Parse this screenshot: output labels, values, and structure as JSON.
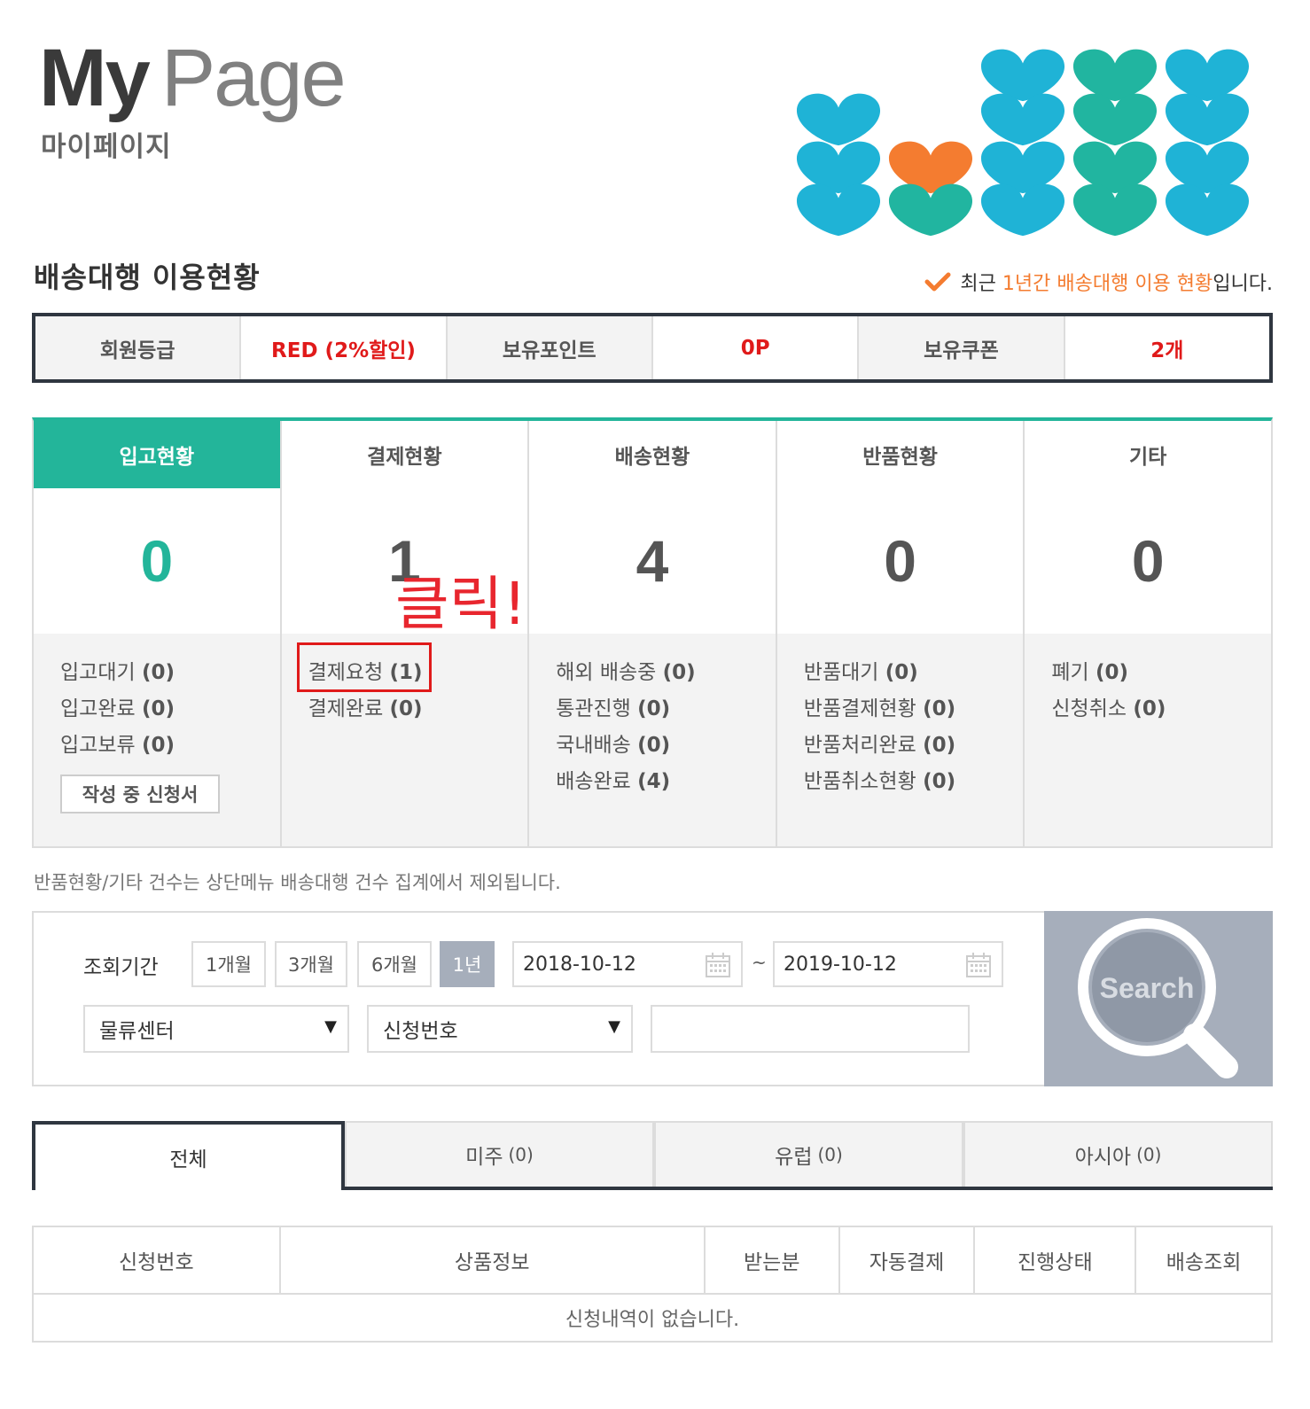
{
  "header": {
    "title_bold": "My",
    "title_light": "Page",
    "subtitle": "마이페이지"
  },
  "section": {
    "title": "배송대행 이용현황",
    "note_prefix": "최근",
    "note_accent": "1년간 배송대행 이용 현황",
    "note_suffix": "입니다."
  },
  "info_bar": [
    {
      "label": "회원등급",
      "value": "RED (2%할인)"
    },
    {
      "label": "보유포인트",
      "value": "0P"
    },
    {
      "label": "보유쿠폰",
      "value": "2개"
    }
  ],
  "status": [
    {
      "title": "입고현황",
      "count": "0",
      "items": [
        {
          "label": "입고대기",
          "count": "(0)"
        },
        {
          "label": "입고완료",
          "count": "(0)"
        },
        {
          "label": "입고보류",
          "count": "(0)"
        }
      ]
    },
    {
      "title": "결제현황",
      "count": "1",
      "items": [
        {
          "label": "결제요청",
          "count": "(1)"
        },
        {
          "label": "결제완료",
          "count": "(0)"
        }
      ]
    },
    {
      "title": "배송현황",
      "count": "4",
      "items": [
        {
          "label": "해외 배송중",
          "count": "(0)"
        },
        {
          "label": "통관진행",
          "count": "(0)"
        },
        {
          "label": "국내배송",
          "count": "(0)"
        },
        {
          "label": "배송완료",
          "count": "(4)"
        }
      ]
    },
    {
      "title": "반품현황",
      "count": "0",
      "items": [
        {
          "label": "반품대기",
          "count": "(0)"
        },
        {
          "label": "반품결제현황",
          "count": "(0)"
        },
        {
          "label": "반품처리완료",
          "count": "(0)"
        },
        {
          "label": "반품취소현황",
          "count": "(0)"
        }
      ]
    },
    {
      "title": "기타",
      "count": "0",
      "items": [
        {
          "label": "폐기",
          "count": "(0)"
        },
        {
          "label": "신청취소",
          "count": "(0)"
        }
      ]
    }
  ],
  "draft_button": "작성 중 신청서",
  "annotation": "클릭!",
  "notice": "반품현황/기타 건수는 상단메뉴 배송대행 건수 집계에서 제외됩니다.",
  "search": {
    "period_label": "조회기간",
    "periods": [
      "1개월",
      "3개월",
      "6개월",
      "1년"
    ],
    "selected_period": "1년",
    "date_from": "2018-10-12",
    "date_to": "2019-10-12",
    "tilde": "~",
    "select_center": "물류센터",
    "select_field": "신청번호",
    "keyword": "",
    "button_label": "Search"
  },
  "tabs": [
    {
      "label": "전체",
      "count": ""
    },
    {
      "label": "미주",
      "count": "(0)"
    },
    {
      "label": "유럽",
      "count": "(0)"
    },
    {
      "label": "아시아",
      "count": "(0)"
    }
  ],
  "table": {
    "headers": [
      "신청번호",
      "상품정보",
      "받는분",
      "자동결제",
      "진행상태",
      "배송조회"
    ],
    "empty": "신청내역이 없습니다."
  },
  "colors": {
    "accent_teal": "#23b59a",
    "accent_orange": "#f47c30",
    "alert_red": "#e01a1a",
    "search_bg": "#a6aebb",
    "logo_blue": "#1fb3d6",
    "logo_green": "#21b5a0"
  }
}
